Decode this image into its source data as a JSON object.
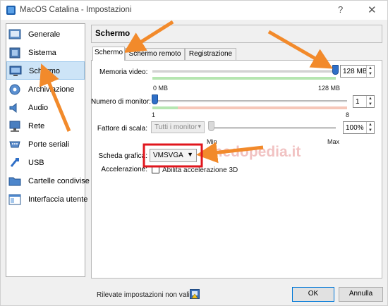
{
  "window": {
    "title": "MacOS Catalina - Impostazioni",
    "help_label": "?",
    "close_label": "✕"
  },
  "sidebar": {
    "items": [
      {
        "label": "Generale",
        "icon": "general-icon"
      },
      {
        "label": "Sistema",
        "icon": "system-chip-icon"
      },
      {
        "label": "Schermo",
        "icon": "display-monitor-icon",
        "selected": true
      },
      {
        "label": "Archiviazione",
        "icon": "storage-disk-icon"
      },
      {
        "label": "Audio",
        "icon": "speaker-icon"
      },
      {
        "label": "Rete",
        "icon": "network-icon"
      },
      {
        "label": "Porte seriali",
        "icon": "serial-port-icon"
      },
      {
        "label": "USB",
        "icon": "usb-icon"
      },
      {
        "label": "Cartelle condivise",
        "icon": "shared-folder-icon"
      },
      {
        "label": "Interfaccia utente",
        "icon": "user-interface-icon"
      }
    ]
  },
  "panel": {
    "title": "Schermo",
    "tabs": [
      "Schermo",
      "Schermo remoto",
      "Registrazione"
    ],
    "active_tab": "Schermo"
  },
  "video_memory": {
    "label": "Memoria video:",
    "value": "128 MB",
    "min_label": "0 MB",
    "max_label": "128 MB",
    "level": 1.0
  },
  "monitors": {
    "label": "Numero di monitor:",
    "value": "1",
    "min_label": "1",
    "max_label": "8",
    "level": 0.0
  },
  "scale": {
    "label": "Fattore di scala:",
    "combo_value": "Tutti i monitor",
    "value": "100%",
    "min_label": "Min",
    "max_label": "Max"
  },
  "graphics_controller": {
    "label": "Scheda grafica:",
    "value": "VMSVGA"
  },
  "acceleration": {
    "label": "Accelerazione:",
    "checkbox_label": "Abilita accelerazione 3D",
    "checked": false
  },
  "footer": {
    "status": "Rilevate impostazioni non valide",
    "ok_label": "OK",
    "cancel_label": "Annulla"
  },
  "watermark": "chedopedia.it",
  "colors": {
    "accent": "#2f6fc7",
    "arrow": "#f28a2b",
    "highlight_box": "#e0161d",
    "sidebar_selected": "#cde4f7"
  }
}
